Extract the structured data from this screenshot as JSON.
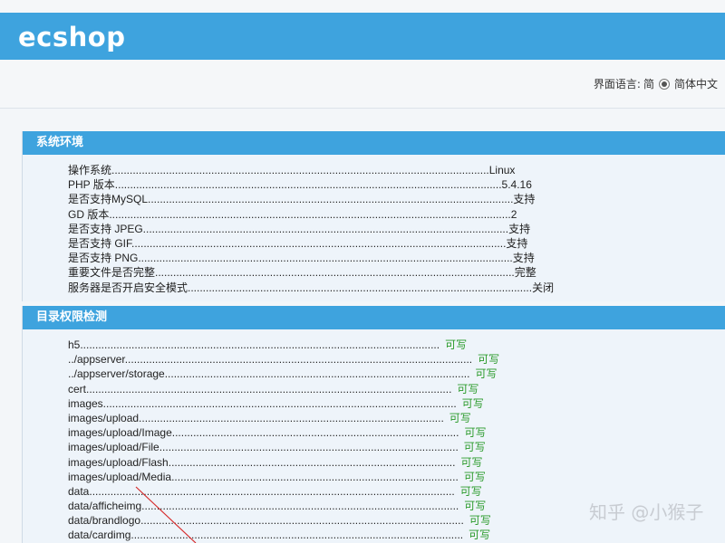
{
  "header": {
    "logo_text": "ecshop"
  },
  "lang": {
    "label": "界面语言:",
    "option1": "简",
    "option2": "简体中文"
  },
  "env": {
    "title": "系统环境",
    "rows": [
      "操作系统.............................................................................................................................Linux",
      "PHP 版本................................................................................................................................5.4.16",
      "是否支持MySQL.........................................................................................................................支持",
      "GD 版本.....................................................................................................................................2",
      "是否支持 JPEG.........................................................................................................................支持",
      "是否支持 GIF............................................................................................................................支持",
      "是否支持 PNG............................................................................................................................支持",
      "重要文件是否完整.......................................................................................................................完整",
      "服务器是否开启安全模式..................................................................................................................关闭"
    ]
  },
  "dir": {
    "title": "目录权限检测",
    "rows": [
      {
        "path": "h5.......................................................................................................................",
        "status": "可写"
      },
      {
        "path": "../appserver...................................................................................................................",
        "status": "可写"
      },
      {
        "path": "../appserver/storage.....................................................................................................",
        "status": "可写"
      },
      {
        "path": "cert.........................................................................................................................",
        "status": "可写"
      },
      {
        "path": "images.....................................................................................................................",
        "status": "可写"
      },
      {
        "path": "images/upload.....................................................................................................",
        "status": "可写"
      },
      {
        "path": "images/upload/Image...............................................................................................",
        "status": "可写"
      },
      {
        "path": "images/upload/File...................................................................................................",
        "status": "可写"
      },
      {
        "path": "images/upload/Flash...............................................................................................",
        "status": "可写"
      },
      {
        "path": "images/upload/Media...............................................................................................",
        "status": "可写"
      },
      {
        "path": "data.........................................................................................................................",
        "status": "可写"
      },
      {
        "path": "data/afficheimg.........................................................................................................",
        "status": "可写"
      },
      {
        "path": "data/brandlogo...........................................................................................................",
        "status": "可写"
      },
      {
        "path": "data/cardimg..............................................................................................................",
        "status": "可写"
      }
    ]
  },
  "watermark": "知乎 @小猴子"
}
